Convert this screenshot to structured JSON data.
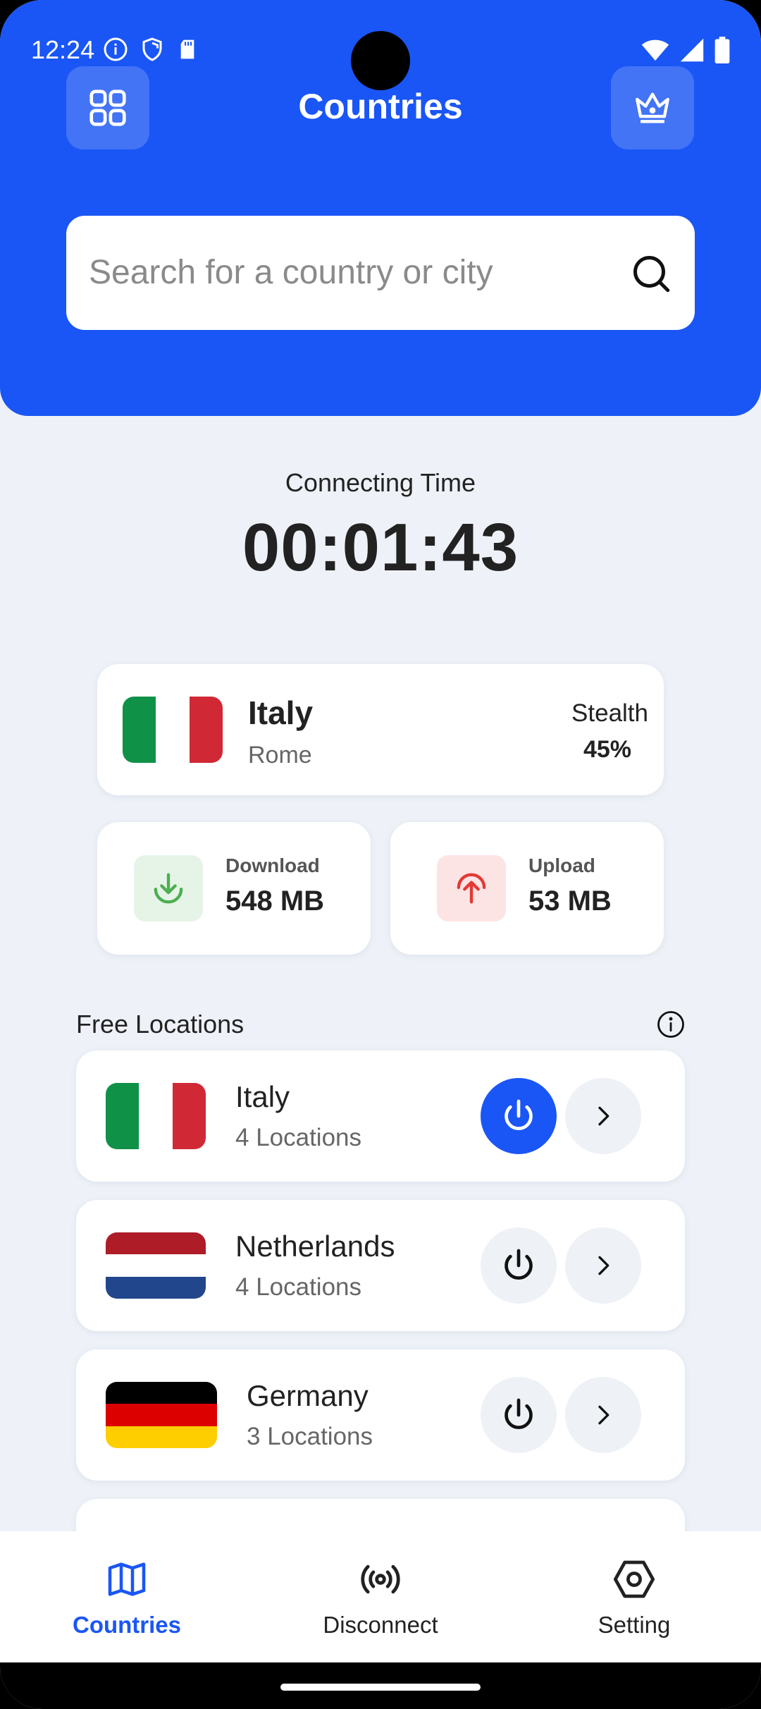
{
  "status_bar": {
    "time": "12:24"
  },
  "header": {
    "title": "Countries"
  },
  "search": {
    "placeholder": "Search for a country or city"
  },
  "connection": {
    "label": "Connecting Time",
    "time": "00:01:43"
  },
  "current_server": {
    "country": "Italy",
    "city": "Rome",
    "mode_label": "Stealth",
    "mode_value": "45%"
  },
  "stats": {
    "download": {
      "label": "Download",
      "value": "548 MB"
    },
    "upload": {
      "label": "Upload",
      "value": "53 MB"
    }
  },
  "free_locations": {
    "title": "Free Locations",
    "items": [
      {
        "country": "Italy",
        "count": "4 Locations",
        "connected": true
      },
      {
        "country": "Netherlands",
        "count": "4 Locations",
        "connected": false
      },
      {
        "country": "Germany",
        "count": "3 Locations",
        "connected": false
      }
    ]
  },
  "nav": {
    "countries": "Countries",
    "disconnect": "Disconnect",
    "setting": "Setting"
  },
  "colors": {
    "accent": "#1a56f5",
    "background": "#eef2f8",
    "download_green": "#4caf50",
    "upload_red": "#e53935",
    "italy": [
      "#0f9248",
      "#ffffff",
      "#d02935"
    ],
    "netherlands": [
      "#ae1c28",
      "#ffffff",
      "#21468b"
    ],
    "germany": [
      "#000000",
      "#dd0000",
      "#ffce00"
    ]
  }
}
